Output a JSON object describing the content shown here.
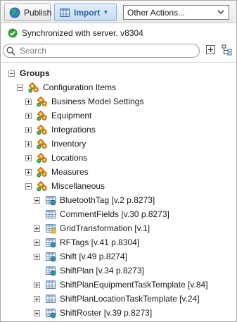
{
  "toolbar": {
    "publish_label": "Publish",
    "import_label": "Import",
    "actions_select_value": "Other Actions..."
  },
  "status": {
    "text": "Synchronized with server. v8304"
  },
  "search": {
    "placeholder": "Search"
  },
  "tree": {
    "root_label": "Groups",
    "config_label": "Configuration Items",
    "categories": [
      "Business Model Settings",
      "Equipment",
      "Integrations",
      "Inventory",
      "Locations",
      "Measures",
      "Miscellaneous"
    ],
    "misc_items": [
      "BluetoothTag [v.2 p.8273]",
      "CommentFields [v.30 p.8273]",
      "GridTransformation [v.1]",
      "RFTags [v.41 p.8304]",
      "Shift [v.49 p.8274]",
      "ShiftPlan [v.34 p.8273]",
      "ShiftPlanEquipmentTaskTemplate [v.84]",
      "ShiftPlanLocationTaskTemplate [v.24]",
      "ShiftRoster [v.39 p.8273]"
    ]
  }
}
